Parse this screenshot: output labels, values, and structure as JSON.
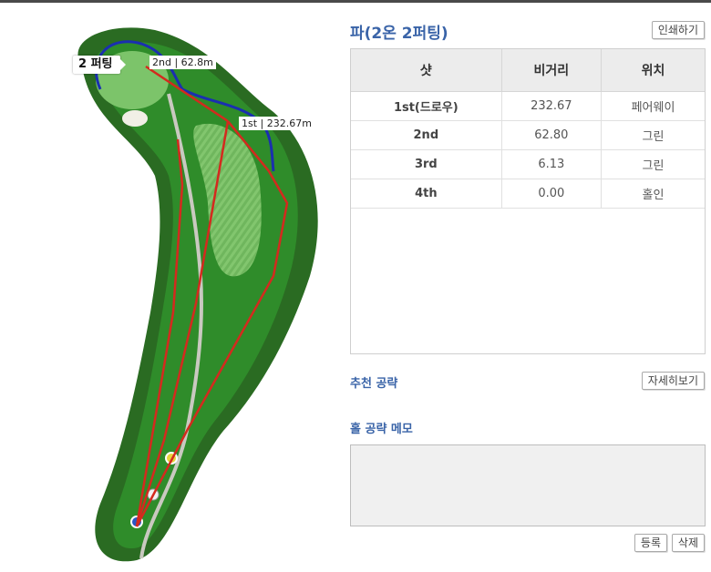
{
  "hole_map": {
    "putt_tag": "2 퍼팅",
    "labels": {
      "second_shot": "2nd | 62.8m",
      "first_shot": "1st | 232.67m"
    }
  },
  "result": {
    "title": "파(2온 2퍼팅)",
    "print_button": "인쇄하기"
  },
  "shot_table": {
    "headers": [
      "샷",
      "비거리",
      "위치"
    ],
    "rows": [
      {
        "shot": "1st(드로우)",
        "distance": "232.67",
        "location": "페어웨이"
      },
      {
        "shot": "2nd",
        "distance": "62.80",
        "location": "그린"
      },
      {
        "shot": "3rd",
        "distance": "6.13",
        "location": "그린"
      },
      {
        "shot": "4th",
        "distance": "0.00",
        "location": "홀인"
      }
    ]
  },
  "recommend": {
    "label": "추천 공략",
    "detail_button": "자세히보기"
  },
  "memo": {
    "label": "홀 공략 메모",
    "value": "",
    "register_button": "등록",
    "delete_button": "삭제"
  },
  "colors": {
    "accent": "#3a64a8",
    "shot_line": "#d42a1e",
    "ob_line": "#1a2fb0",
    "fairway": "#2e8a2a",
    "green": "#7cc46a"
  }
}
